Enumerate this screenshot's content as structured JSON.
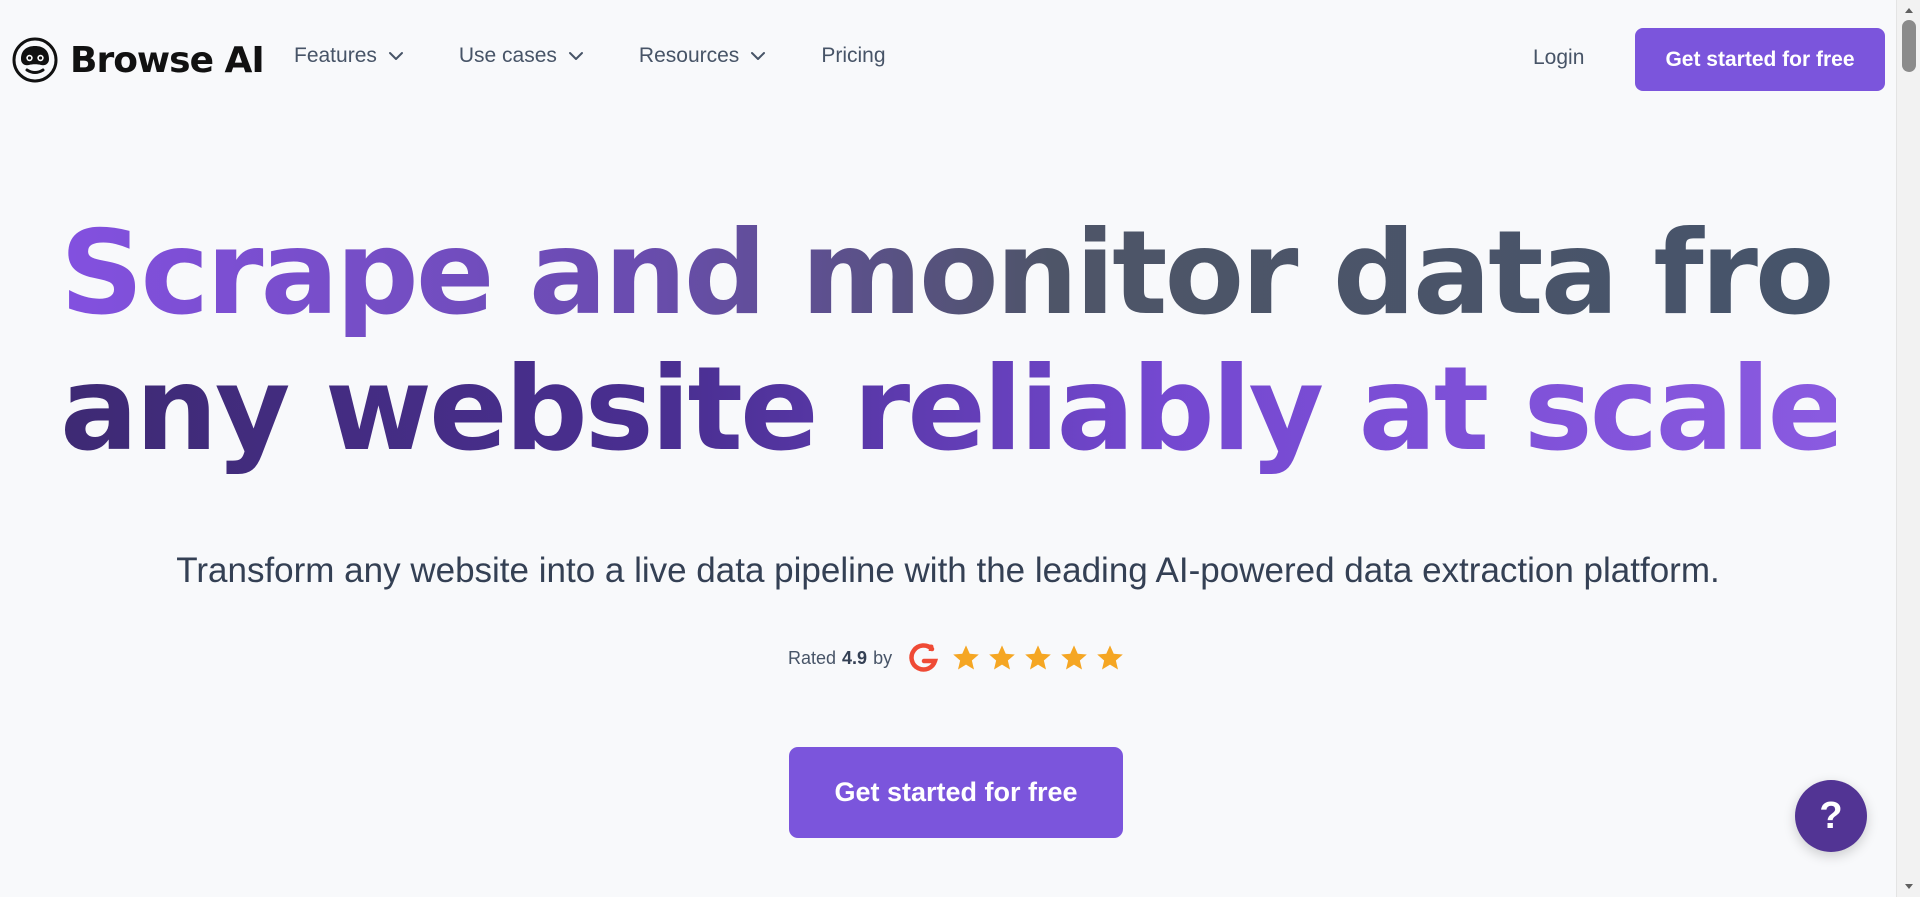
{
  "header": {
    "brand": "Browse AI",
    "logo_icon": "robot-face-icon",
    "nav": [
      {
        "label": "Features",
        "has_dropdown": true
      },
      {
        "label": "Use cases",
        "has_dropdown": true
      },
      {
        "label": "Resources",
        "has_dropdown": true
      },
      {
        "label": "Pricing",
        "has_dropdown": false
      }
    ],
    "login_label": "Login",
    "cta_label": "Get started for free"
  },
  "hero": {
    "title_line_1": "Scrape and monitor data from",
    "title_line_2": "any website reliably at scale",
    "subtitle": "Transform any website into a live data pipeline with the leading AI-powered data extraction platform.",
    "rating": {
      "rated_label": "Rated",
      "score": "4.9",
      "by_label": "by",
      "provider_icon": "g2-logo-icon",
      "stars": 5
    },
    "cta_label": "Get started for free"
  },
  "help": {
    "label": "?"
  },
  "colors": {
    "accent": "#7b55dc",
    "accent_dark": "#523494",
    "star": "#f5a623",
    "g2_red": "#ef4a35",
    "text_body": "#344054",
    "nav_text": "#475467",
    "background": "#f8f9fb"
  }
}
